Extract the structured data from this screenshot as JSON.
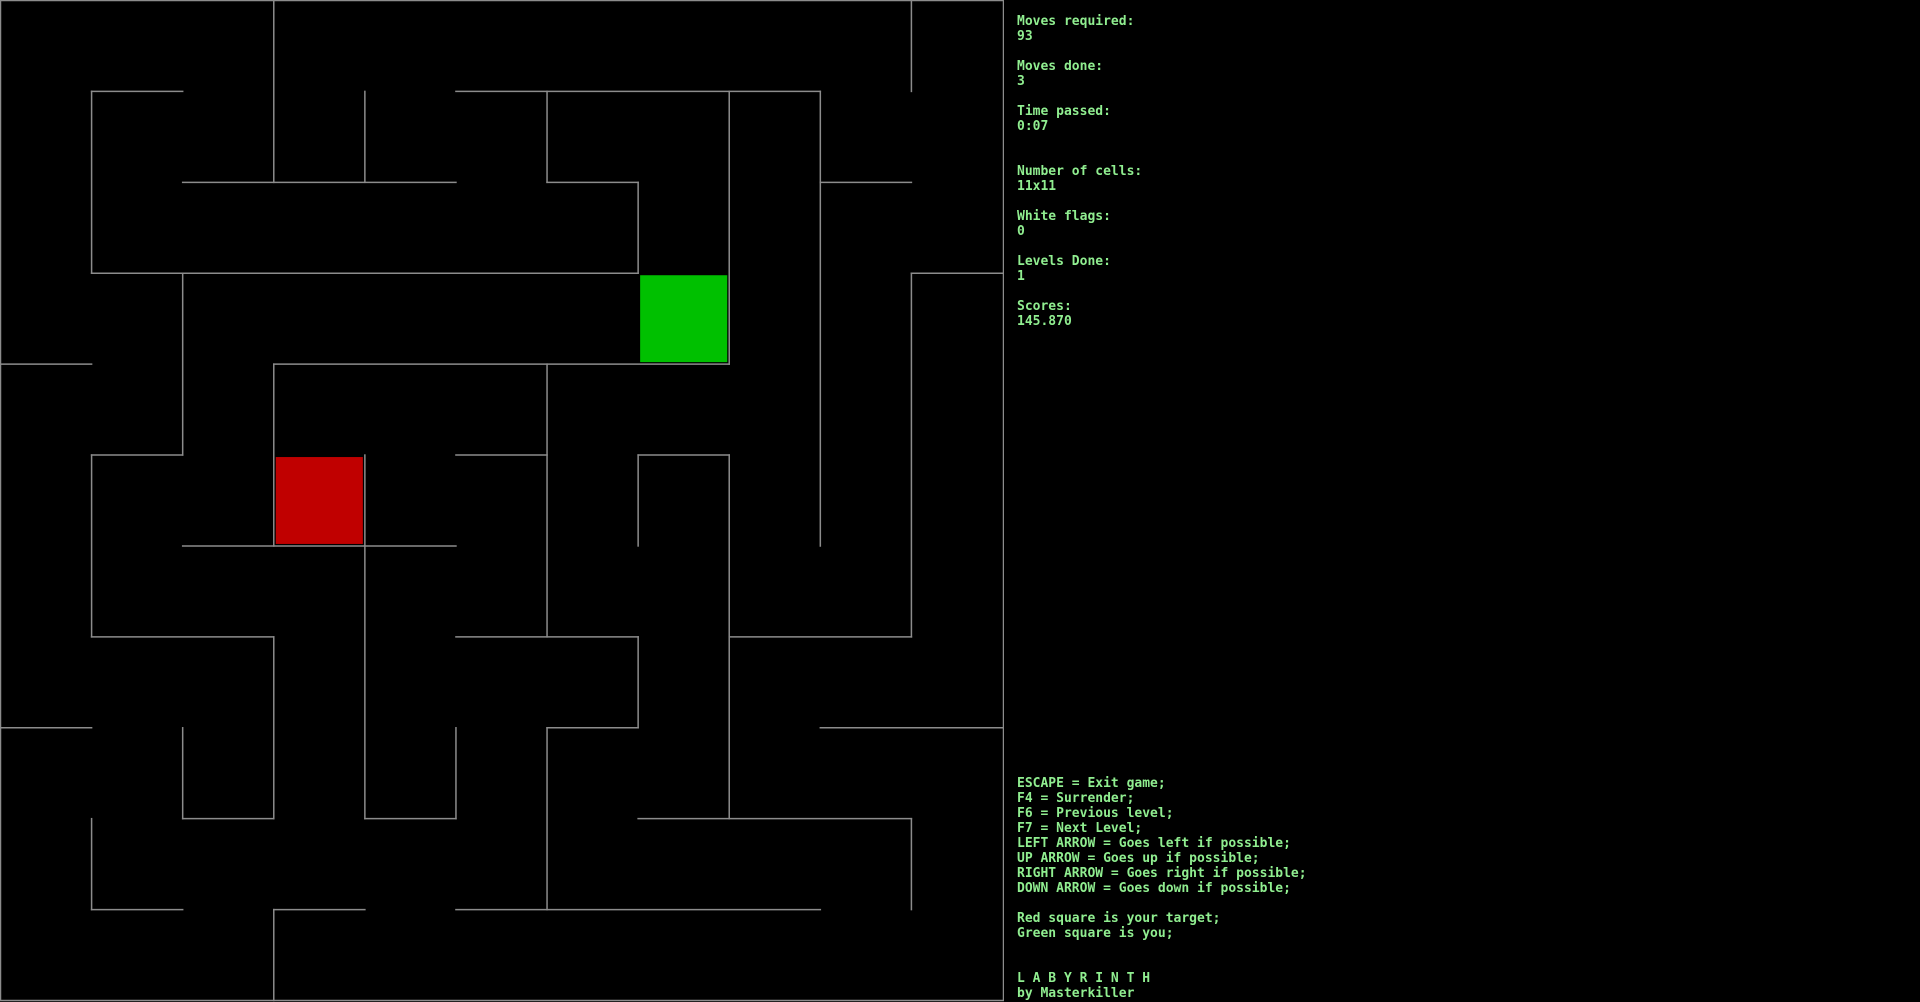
{
  "colors": {
    "background": "#000000",
    "text": "#90ee90",
    "wall": "#8c8c8c",
    "player": "#00c000",
    "target": "#c00000"
  },
  "stats": {
    "moves_required_label": "Moves required:",
    "moves_required_value": "93",
    "moves_done_label": "Moves done:",
    "moves_done_value": "3",
    "time_passed_label": "Time passed:",
    "time_passed_value": "0:07",
    "cells_label": "Number of cells:",
    "cells_value": "11x11",
    "white_flags_label": "White flags:",
    "white_flags_value": "0",
    "levels_done_label": "Levels Done:",
    "levels_done_value": "1",
    "scores_label": "Scores:",
    "scores_value": "145.870"
  },
  "controls": [
    "ESCAPE = Exit game;",
    "F4 = Surrender;",
    "F6 = Previous level;",
    "F7 = Next Level;",
    "LEFT ARROW = Goes left if possible;",
    "UP ARROW = Goes up if possible;",
    "RIGHT ARROW = Goes right if possible;",
    "DOWN ARROW = Goes down if possible;"
  ],
  "legend": [
    "Red square is your target;",
    "Green square is you;"
  ],
  "credits": {
    "title": "L A B Y R I N T H",
    "author": "by Masterkiller"
  },
  "maze": {
    "cells": 11,
    "player_cell": {
      "col": 7,
      "row": 3
    },
    "target_cell": {
      "col": 3,
      "row": 5
    },
    "walls_h": [
      [
        1,
        1,
        2
      ],
      [
        5,
        1,
        9
      ],
      [
        2,
        2,
        5
      ],
      [
        6,
        2,
        7
      ],
      [
        9,
        2,
        10
      ],
      [
        1,
        3,
        7
      ],
      [
        10,
        3,
        11
      ],
      [
        0,
        4,
        1
      ],
      [
        3,
        4,
        8
      ],
      [
        1,
        5,
        2
      ],
      [
        5,
        5,
        6
      ],
      [
        7,
        5,
        8
      ],
      [
        2,
        6,
        5
      ],
      [
        1,
        7,
        3
      ],
      [
        5,
        7,
        7
      ],
      [
        8,
        7,
        10
      ],
      [
        0,
        8,
        1
      ],
      [
        6,
        8,
        7
      ],
      [
        9,
        8,
        11
      ],
      [
        2,
        9,
        3
      ],
      [
        4,
        9,
        5
      ],
      [
        7,
        9,
        10
      ],
      [
        1,
        10,
        2
      ],
      [
        3,
        10,
        4
      ],
      [
        5,
        10,
        9
      ]
    ],
    "walls_v": [
      [
        3,
        0,
        2
      ],
      [
        10,
        0,
        1
      ],
      [
        1,
        1,
        3
      ],
      [
        4,
        1,
        2
      ],
      [
        6,
        1,
        2
      ],
      [
        8,
        1,
        4
      ],
      [
        9,
        1,
        6
      ],
      [
        7,
        2,
        3
      ],
      [
        2,
        3,
        5
      ],
      [
        10,
        3,
        7
      ],
      [
        3,
        4,
        6
      ],
      [
        6,
        4,
        7
      ],
      [
        1,
        5,
        7
      ],
      [
        4,
        5,
        6
      ],
      [
        7,
        5,
        6
      ],
      [
        8,
        5,
        9
      ],
      [
        3,
        7,
        9
      ],
      [
        4,
        6,
        9
      ],
      [
        7,
        7,
        8
      ],
      [
        2,
        8,
        9
      ],
      [
        5,
        8,
        9
      ],
      [
        6,
        8,
        10
      ],
      [
        1,
        9,
        10
      ],
      [
        10,
        9,
        10
      ],
      [
        3,
        10,
        11
      ]
    ]
  }
}
